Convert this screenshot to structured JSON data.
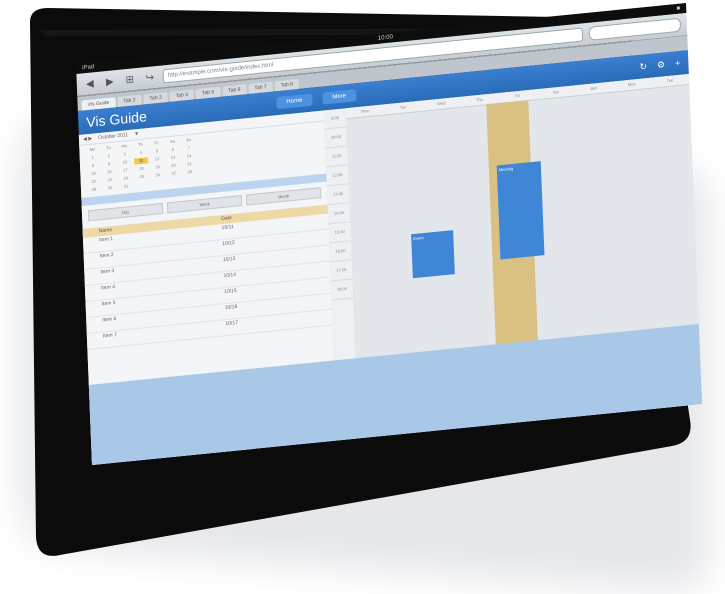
{
  "device": {
    "status_left": "iPad",
    "status_time": "10:00",
    "status_right": "■"
  },
  "browser": {
    "back": "◀",
    "forward": "▶",
    "bookmarks": "⊞",
    "share": "↪",
    "url": "http://example.com/vis-guide/index.html",
    "tabs": [
      {
        "label": "Vis Guide",
        "active": true
      },
      {
        "label": "Tab 2",
        "active": false
      },
      {
        "label": "Tab 3",
        "active": false
      },
      {
        "label": "Tab 4",
        "active": false
      },
      {
        "label": "Tab 5",
        "active": false
      },
      {
        "label": "Tab 6",
        "active": false
      },
      {
        "label": "Tab 7",
        "active": false
      },
      {
        "label": "Tab 8",
        "active": false
      }
    ]
  },
  "app": {
    "title": "Vis Guide",
    "btn_home": "Home",
    "btn_more": "More",
    "icon_refresh": "↻",
    "icon_settings": "⚙",
    "icon_plus": "+"
  },
  "left": {
    "header": [
      "◀ ▶",
      "October 2011",
      "▼"
    ],
    "cal_days": [
      "Mo",
      "Tu",
      "We",
      "Th",
      "Fr",
      "Sa",
      "Su",
      "1",
      "2",
      "3",
      "4",
      "5",
      "6",
      "7",
      "8",
      "9",
      "10",
      "11",
      "12",
      "13",
      "14",
      "15",
      "16",
      "17",
      "18",
      "19",
      "20",
      "21",
      "22",
      "23",
      "24",
      "25",
      "26",
      "27",
      "28",
      "29",
      "30",
      "31",
      "",
      "",
      "",
      ""
    ],
    "buttons": [
      "Day",
      "Week",
      "Month"
    ],
    "table_header": [
      "Name",
      "Date"
    ],
    "rows": [
      [
        "Item 1",
        "10/11"
      ],
      [
        "Item 2",
        "10/12"
      ],
      [
        "Item 3",
        "10/13"
      ],
      [
        "Item 4",
        "10/14"
      ],
      [
        "Item 5",
        "10/15"
      ],
      [
        "Item 6",
        "10/16"
      ],
      [
        "Item 7",
        "10/17"
      ]
    ]
  },
  "mid_cells": [
    "9:00",
    "10:00",
    "11:00",
    "12:00",
    "13:00",
    "14:00",
    "15:00",
    "16:00",
    "17:00",
    "18:00"
  ],
  "right": {
    "cols": [
      "Mon",
      "Tue",
      "Wed",
      "Thu",
      "Fri",
      "Sat",
      "Sun",
      "Mon",
      "Tue"
    ],
    "events": [
      {
        "text": "Event"
      },
      {
        "text": "Meeting"
      }
    ]
  }
}
